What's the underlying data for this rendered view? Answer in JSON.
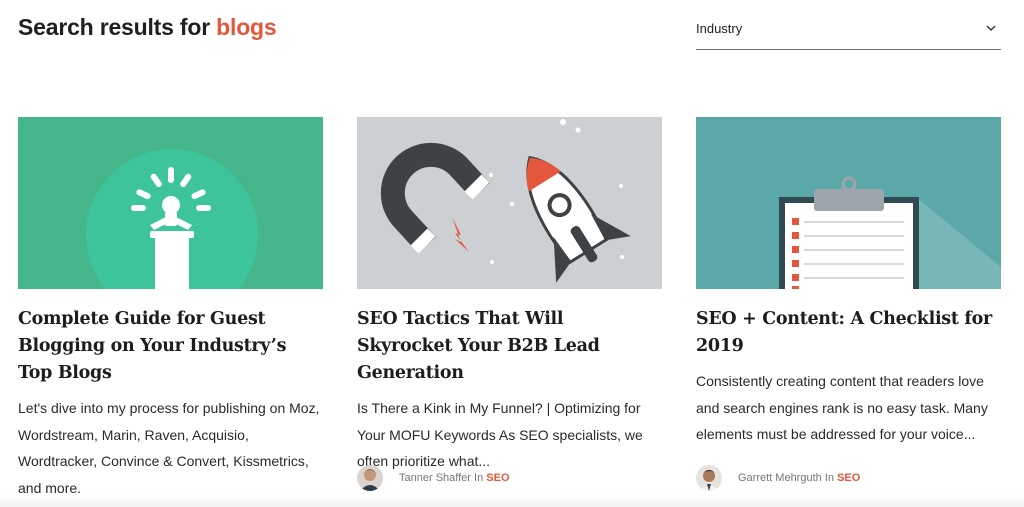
{
  "search": {
    "prefix": "Search results for ",
    "term": "blogs"
  },
  "filter": {
    "label": "Industry",
    "icon": "chevron-down-icon"
  },
  "colors": {
    "accent": "#e4573d",
    "card1_bg": "#44b68a",
    "card2_bg": "#cdd0d2",
    "card3_bg": "#5aa8a8"
  },
  "cards": [
    {
      "title": "Complete Guide for Guest Blogging on Your Industry’s Top Blogs",
      "excerpt": "Let's dive into my process for publishing on Moz, Wordstream, Marin, Raven, Acquisio, Wordtracker, Convince & Convert, Kissmetrics, and more.",
      "image": "speaker-at-podium-illustration"
    },
    {
      "title": "SEO Tactics That Will Skyrocket Your B2B Lead Generation",
      "excerpt": "Is There a Kink in My Funnel? | Optimizing for Your MOFU Keywords As SEO specialists, we often prioritize what...",
      "image": "magnet-and-rocket-illustration",
      "author": "Tanner Shaffer",
      "in": "In",
      "category": "SEO"
    },
    {
      "title": "SEO + Content: A Checklist for 2019",
      "excerpt": "Consistently creating content that readers love and search engines rank is no easy task.  Many elements must be addressed for your voice...",
      "image": "clipboard-checklist-illustration",
      "author": "Garrett Mehrguth",
      "in": "In",
      "category": "SEO"
    }
  ]
}
